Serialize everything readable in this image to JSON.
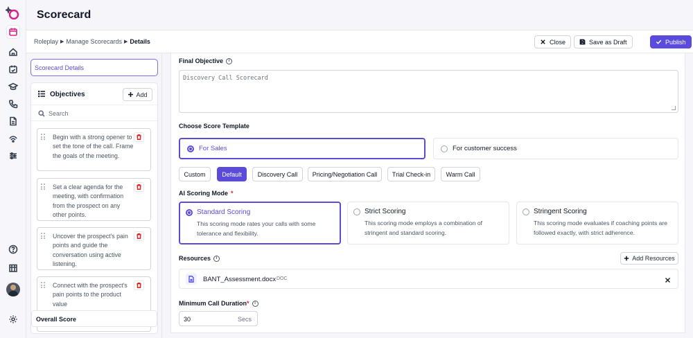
{
  "app": {
    "title": "Scorecard",
    "accent": "#5b4bdb"
  },
  "rail": {
    "icons": [
      "logo-icon",
      "calendar-icon",
      "home-icon",
      "tasks-icon",
      "graduation-cap-icon",
      "phone-icon",
      "document-icon",
      "signal-icon",
      "sliders-icon",
      "help-icon",
      "library-icon",
      "avatar",
      "settings-icon"
    ]
  },
  "breadcrumb": [
    "Roleplay",
    "Manage Scorecards",
    "Details"
  ],
  "actions": {
    "close": "Close",
    "save_draft": "Save as Draft",
    "publish": "Publish"
  },
  "sidebar": {
    "details_tab": "Scorecard Details",
    "objectives_title": "Objectives",
    "add_label": "Add",
    "search_placeholder": "Search",
    "objectives": [
      "Begin with a strong opener to set the tone of the call. Frame the goals of the meeting.",
      "Set a clear agenda for the meeting, with confirmation from the prospect on any other points.",
      "Uncover the prospect's pain points and guide the conversation using active listening.",
      "Connect with the prospect's pain points to the product value"
    ],
    "overall_score": "Overall Score"
  },
  "form": {
    "final_objective_label": "Final Objective",
    "final_objective_placeholder": "Discovery Call Scorecard",
    "score_template_label": "Choose Score Template",
    "templates": [
      {
        "label": "For Sales",
        "selected": true
      },
      {
        "label": "For customer success",
        "selected": false
      }
    ],
    "template_chips": [
      {
        "label": "Custom",
        "selected": false
      },
      {
        "label": "Default",
        "selected": true
      },
      {
        "label": "Discovery Call",
        "selected": false
      },
      {
        "label": "Pricing/Negotiation Call",
        "selected": false
      },
      {
        "label": "Trial Check-in",
        "selected": false
      },
      {
        "label": "Warm Call",
        "selected": false
      }
    ],
    "ai_mode_label": "AI Scoring Mode",
    "modes": [
      {
        "title": "Standard Scoring",
        "desc": "This scoring mode rates your calls with some tolerance and flexibility.",
        "selected": true
      },
      {
        "title": "Strict Scoring",
        "desc": "This scoring mode employs a combination of stringent and standard scoring.",
        "selected": false
      },
      {
        "title": "Stringent Scoring",
        "desc": "This scoring mode evaluates if coaching points are followed exactly, with strict adherence.",
        "selected": false
      }
    ],
    "resources_label": "Resources",
    "add_resources": "Add Resources",
    "resource": {
      "name": "BANT_Assessment.docx",
      "type": "DOC"
    },
    "min_duration_label": "Minimum Call Duration",
    "min_duration_value": "30",
    "min_duration_unit": "Secs"
  }
}
